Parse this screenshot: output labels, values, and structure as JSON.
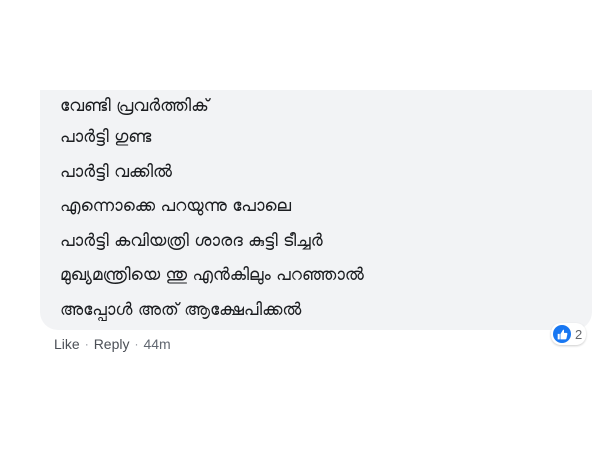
{
  "comment": {
    "lines": [
      "വേണ്ടി പ്രവർത്തിക്",
      "പാർട്ടി ഗുണ്ട",
      "പാർട്ടി വക്കിൽ",
      "എന്നൊക്കെ പറയുന്നു പോലെ",
      "പാർട്ടി കവിയത്രി ശാരദ കുട്ടി ടീച്ചർ",
      "മുഖ്യമന്ത്രിയെ ന്തു എൻകിലും പറഞ്ഞാൽ",
      "അപ്പോൾ അത് ആക്ഷേപിക്കൽ"
    ]
  },
  "reaction": {
    "icon": "thumbs-up-icon",
    "count": "2",
    "color": "#1877f2"
  },
  "actions": {
    "like": "Like",
    "separator": "·",
    "reply": "Reply",
    "time": "44m"
  }
}
